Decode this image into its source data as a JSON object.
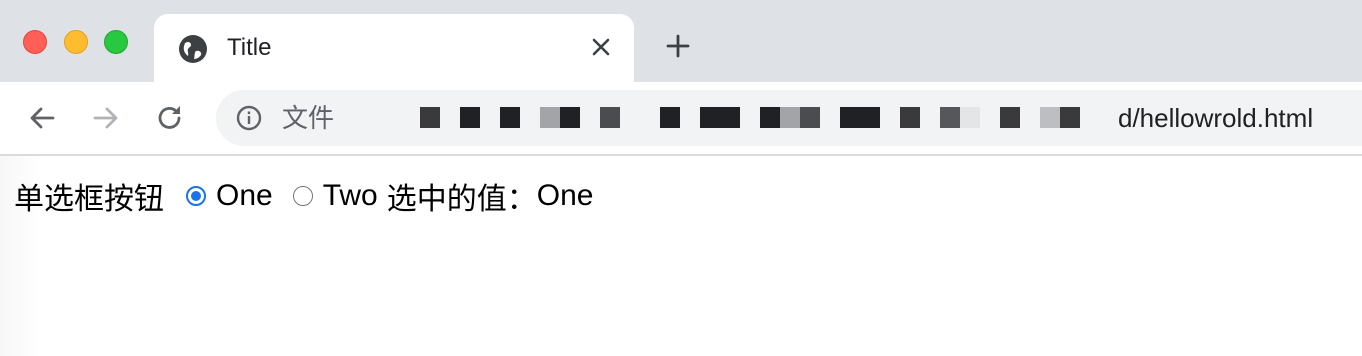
{
  "window": {
    "controls": {
      "close_color": "#ff5f57",
      "minimize_color": "#febc2e",
      "zoom_color": "#28c840"
    }
  },
  "tab": {
    "title": "Title",
    "favicon": "globe-icon"
  },
  "toolbar": {
    "scheme_label": "文件",
    "url_visible": "d/hellowrold.html"
  },
  "page": {
    "label": "单选框按钮",
    "options": [
      {
        "label": "One",
        "checked": true
      },
      {
        "label": "Two",
        "checked": false
      }
    ],
    "selected_label": "选中的值：",
    "selected_value": "One",
    "accent_color": "#1a73e8"
  }
}
